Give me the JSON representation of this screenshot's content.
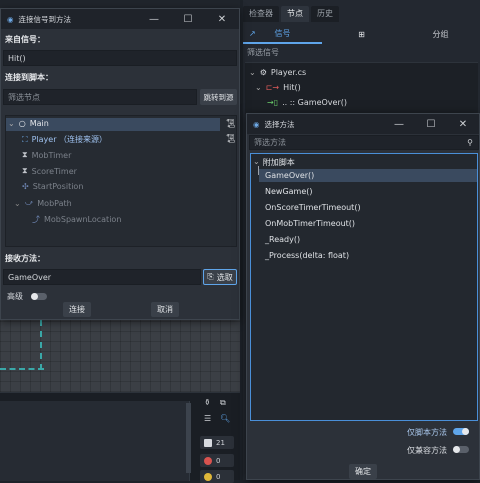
{
  "editor": {
    "bottom_counts": {
      "info": "21",
      "errors": "0",
      "warnings": "0"
    },
    "colors": {
      "error": "#d9534f",
      "warning": "#e0b83a"
    }
  },
  "dock": {
    "tabs": [
      "检查器",
      "节点",
      "历史"
    ],
    "active_tab": "节点",
    "signal_label": "信号",
    "group_label": "分组",
    "filter_label": "筛选信号",
    "tree": {
      "script": "Player.cs",
      "signal": "Hit()",
      "connection": ".. :: GameOver()"
    }
  },
  "connect_dialog": {
    "title": "连接信号到方法",
    "from_signal_label": "来自信号：",
    "from_signal_value": "Hit()",
    "connect_to_script_label": "连接到脚本：",
    "filter_placeholder": "筛选节点",
    "goto_source_label": "跳转到源",
    "nodes": [
      {
        "name": "Main",
        "icon": "circle-icon"
      },
      {
        "name": "Player （连接来源）",
        "icon": "area-icon"
      },
      {
        "name": "MobTimer",
        "icon": "timer-icon"
      },
      {
        "name": "ScoreTimer",
        "icon": "timer-icon"
      },
      {
        "name": "StartPosition",
        "icon": "marker-icon"
      },
      {
        "name": "MobPath",
        "icon": "path-icon"
      },
      {
        "name": "MobSpawnLocation",
        "icon": "path-follow-icon"
      }
    ],
    "receiver_method_label": "接收方法：",
    "receiver_method_value": "GameOver",
    "pick_button": "选取",
    "advanced_label": "高级",
    "connect_button": "连接",
    "cancel_button": "取消"
  },
  "method_dialog": {
    "title": "选择方法",
    "filter_placeholder": "筛选方法",
    "group_label": "附加脚本",
    "methods": [
      "GameOver()",
      "NewGame()",
      "OnScoreTimerTimeout()",
      "OnMobTimerTimeout()",
      "_Ready()",
      "_Process(delta: float)"
    ],
    "script_methods_only_label": "仅脚本方法",
    "compatible_methods_only_label": "仅兼容方法",
    "ok_button": "确定"
  }
}
